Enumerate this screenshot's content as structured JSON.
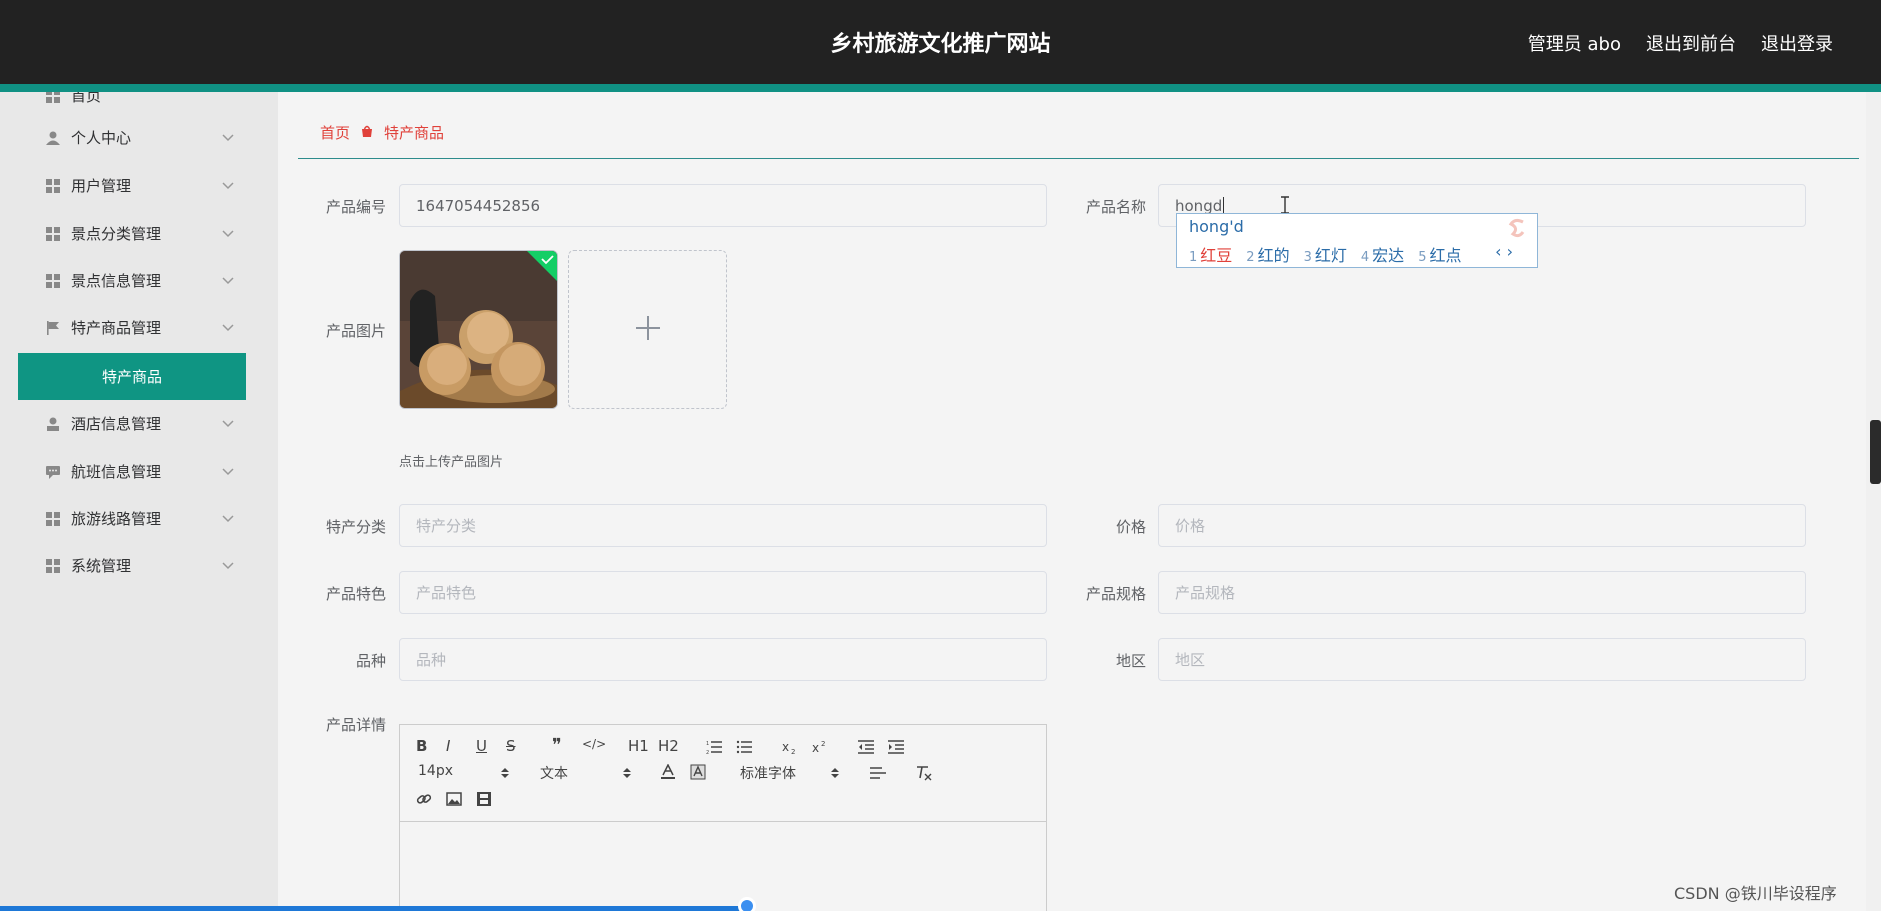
{
  "header": {
    "site_title": "乡村旅游文化推广网站",
    "links": [
      "管理员 abo",
      "退出到前台",
      "退出登录"
    ]
  },
  "sidebar": {
    "items": [
      {
        "label": "首页",
        "icon": "home-icon"
      },
      {
        "label": "个人中心",
        "icon": "user-icon"
      },
      {
        "label": "用户管理",
        "icon": "grid-icon"
      },
      {
        "label": "景点分类管理",
        "icon": "grid-icon"
      },
      {
        "label": "景点信息管理",
        "icon": "grid-icon"
      },
      {
        "label": "特产商品管理",
        "icon": "flag-icon"
      },
      {
        "label": "酒店信息管理",
        "icon": "user-icon"
      },
      {
        "label": "航班信息管理",
        "icon": "chat-icon"
      },
      {
        "label": "旅游线路管理",
        "icon": "grid-icon"
      },
      {
        "label": "系统管理",
        "icon": "grid-icon"
      }
    ],
    "active_sub": "特产商品"
  },
  "breadcrumb": {
    "home": "首页",
    "current": "特产商品"
  },
  "form": {
    "product_no_label": "产品编号",
    "product_no_value": "1647054452856",
    "product_name_label": "产品名称",
    "product_name_value": "hongd",
    "image_label": "产品图片",
    "image_hint": "点击上传产品图片",
    "category_label": "特产分类",
    "category_ph": "特产分类",
    "price_label": "价格",
    "price_ph": "价格",
    "feature_label": "产品特色",
    "feature_ph": "产品特色",
    "spec_label": "产品规格",
    "spec_ph": "产品规格",
    "variety_label": "品种",
    "variety_ph": "品种",
    "region_label": "地区",
    "region_ph": "地区",
    "detail_label": "产品详情"
  },
  "ime": {
    "composition": "hong'd",
    "candidates": [
      {
        "n": "1",
        "text": "红豆"
      },
      {
        "n": "2",
        "text": "红的"
      },
      {
        "n": "3",
        "text": "红灯"
      },
      {
        "n": "4",
        "text": "宏达"
      },
      {
        "n": "5",
        "text": "红点"
      }
    ],
    "arrows": "‹ ›"
  },
  "editor": {
    "font_size": "14px",
    "para_style": "文本",
    "font_family": "标准字体",
    "tools": [
      "B",
      "I",
      "U",
      "S",
      "❞",
      "</>",
      "H1",
      "H2"
    ]
  },
  "watermark": "CSDN @铁川毕设程序"
}
